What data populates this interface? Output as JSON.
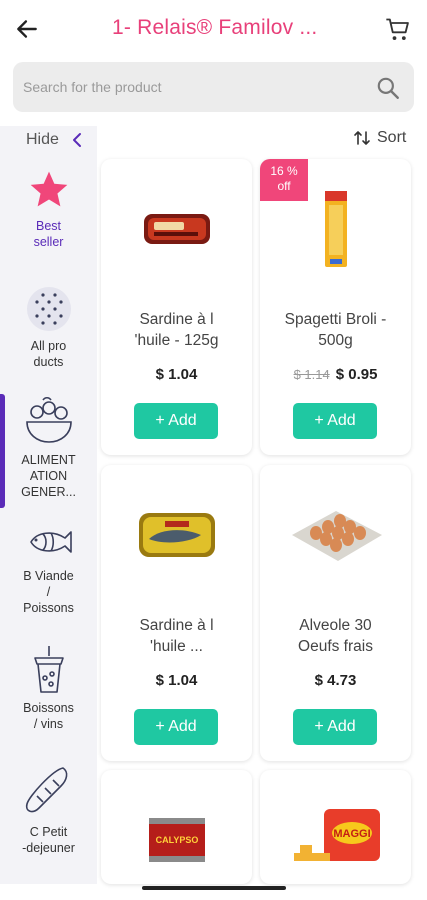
{
  "header": {
    "title": "1- Relais® Familov  ...",
    "back_icon": "arrow-left-icon",
    "cart_icon": "cart-icon"
  },
  "search": {
    "placeholder": "Search for the product",
    "value": ""
  },
  "sidebar": {
    "hide_label": "Hide",
    "categories": [
      {
        "label": "Best seller",
        "icon": "star-icon"
      },
      {
        "label": "All products",
        "icon": "dots-grid-icon"
      },
      {
        "label": "ALIMENTATION GENER...",
        "icon": "salad-bowl-icon"
      },
      {
        "label": "B Viande / Poissons",
        "icon": "fish-icon"
      },
      {
        "label": "Boissons / vins",
        "icon": "drink-cup-icon"
      },
      {
        "label": "C Petit -dejeuner",
        "icon": "bread-icon"
      }
    ],
    "labels_display": [
      "Best\nseller",
      "All pro\nducts",
      "ALIMENT\nATION\nGENER...",
      "B Viande\n/\nPoissons",
      "Boissons\n/ vins",
      "C Petit\n-dejeuner"
    ]
  },
  "sort": {
    "label": "Sort"
  },
  "products": [
    {
      "name": "Sardine à l 'huile - 125g",
      "name_display": "Sardine à l\n'huile - 125g",
      "price": "$ 1.04",
      "old_price": "",
      "badge": "",
      "add_label": "+ Add"
    },
    {
      "name": "Spagetti Broli - 500g",
      "name_display": "Spagetti Broli -\n500g",
      "price": "$ 0.95",
      "old_price": "$ 1.14",
      "badge": "16 % off",
      "badge_display": "16 %\noff",
      "add_label": "+ Add"
    },
    {
      "name": "Sardine à l 'huile ...",
      "name_display": "Sardine à l\n'huile ...",
      "price": "$ 1.04",
      "old_price": "",
      "badge": "",
      "add_label": "+ Add"
    },
    {
      "name": "Alveole 30 Oeufs frais",
      "name_display": "Alveole 30\nOeufs frais",
      "price": "$ 4.73",
      "old_price": "",
      "badge": "",
      "add_label": "+ Add"
    },
    {
      "name": "",
      "price": "",
      "image_text": "CALYPSO"
    },
    {
      "name": "",
      "price": "",
      "image_text": "MAGGI"
    }
  ],
  "colors": {
    "brand_pink": "#e8407a",
    "accent_teal": "#1fc8a2",
    "sidebar_purple": "#5a2bb8",
    "badge_pink": "#f0467a"
  }
}
